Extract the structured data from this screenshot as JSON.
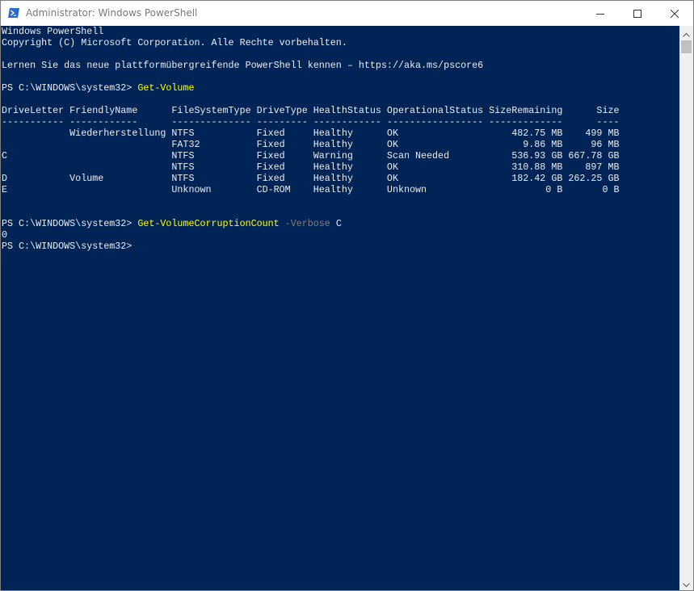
{
  "window": {
    "title": "Administrator: Windows PowerShell",
    "controls": {
      "minimize": "minimize",
      "maximize": "maximize",
      "close": "close"
    }
  },
  "console": {
    "header_lines": [
      "Windows PowerShell",
      "Copyright (C) Microsoft Corporation. Alle Rechte vorbehalten.",
      "",
      "Lernen Sie das neue plattformübergreifende PowerShell kennen – https://aka.ms/pscore6",
      ""
    ],
    "prompt": "PS C:\\WINDOWS\\system32> ",
    "command1": "Get-Volume",
    "table_header": "DriveLetter FriendlyName      FileSystemType DriveType HealthStatus OperationalStatus SizeRemaining      Size",
    "table_separator": "----------- ------------      -------------- --------- ------------ ----------------- -------------      ----",
    "table_rows": [
      "            Wiederherstellung NTFS           Fixed     Healthy      OK                    482.75 MB    499 MB",
      "                              FAT32          Fixed     Healthy      OK                      9.86 MB     96 MB",
      "C                             NTFS           Fixed     Warning      Scan Needed           536.93 GB 667.78 GB",
      "                              NTFS           Fixed     Healthy      OK                    310.88 MB    897 MB",
      "D           Volume            NTFS           Fixed     Healthy      OK                    182.42 GB 262.25 GB",
      "E                             Unknown        CD-ROM    Healthy      Unknown                     0 B       0 B"
    ],
    "command2": "Get-VolumeCorruptionCount",
    "command2_param": "-Verbose",
    "command2_arg": "C",
    "output2": "0",
    "final_prompt": "PS C:\\WINDOWS\\system32>"
  },
  "colors": {
    "console_bg": "#012456",
    "console_fg": "#eeedf0",
    "command": "#ffff00",
    "parameter": "#808080"
  }
}
